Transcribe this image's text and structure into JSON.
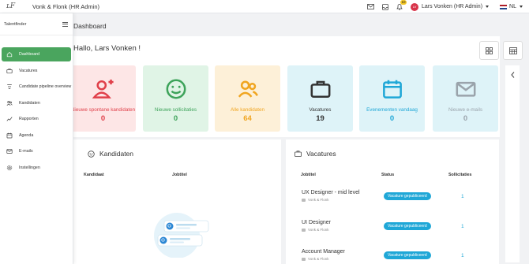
{
  "topbar": {
    "logo": "ʟF",
    "company": "Vonk & Flonk (HR Admin)",
    "notification_count": "10",
    "user_initials": "LV",
    "user_name": "Lars Vonken (HR Admin)",
    "language": "NL"
  },
  "sidebar": {
    "title": "Talentfinder",
    "items": [
      {
        "label": "Dashboard",
        "icon": "home-icon",
        "active": true
      },
      {
        "label": "Vacatures",
        "icon": "briefcase-icon"
      },
      {
        "label": "Candidate pipeline overview",
        "icon": "pipeline-icon"
      },
      {
        "label": "Kandidaten",
        "icon": "users-icon"
      },
      {
        "label": "Rapporten",
        "icon": "chart-line-icon"
      },
      {
        "label": "Agenda",
        "icon": "calendar-icon"
      },
      {
        "label": "E-mails",
        "icon": "mail-icon"
      },
      {
        "label": "Instellingen",
        "icon": "gear-icon"
      }
    ]
  },
  "main": {
    "page_title": "Dashboard",
    "welcome": "Hallo, Lars Vonken !"
  },
  "cards": [
    {
      "label": "Nieuwe spontane kandidaten",
      "value": "0",
      "icon": "user-plus-icon",
      "bg": "#fde6e6",
      "color": "#e0404a"
    },
    {
      "label": "Nieuwe sollicitaties",
      "value": "0",
      "icon": "smiley-icon",
      "bg": "#e0f4e6",
      "color": "#3da35a"
    },
    {
      "label": "Alle kandidaten",
      "value": "64",
      "icon": "users-icon",
      "bg": "#fdf0d8",
      "color": "#f0a520"
    },
    {
      "label": "Vacatures",
      "value": "19",
      "icon": "briefcase-icon",
      "bg": "#def3f8",
      "color": "#333333"
    },
    {
      "label": "Evenementen vandaag",
      "value": "0",
      "icon": "calendar-icon",
      "bg": "#def3f8",
      "color": "#1fa7d7"
    },
    {
      "label": "Nieuwe e-mails",
      "value": "0",
      "icon": "mail-icon",
      "bg": "#def3f8",
      "color": "#9aa3ab"
    }
  ],
  "kandidaten_panel": {
    "title": "Kandidaten",
    "col_candidate": "Kandidaat",
    "col_jobtitle": "Jobtitel"
  },
  "vacatures_panel": {
    "title": "Vacatures",
    "col_jobtitle": "Jobtitel",
    "col_status": "Status",
    "col_applications": "Sollicitaties",
    "rows": [
      {
        "title": "UX Designer - mid level",
        "company": "Vonk & Flonk",
        "status": "Vacature gepubliceerd",
        "applications": "1"
      },
      {
        "title": "UI Designer",
        "company": "Vonk & Flonk",
        "status": "Vacature gepubliceerd",
        "applications": "1"
      },
      {
        "title": "Account Manager",
        "company": "Vonk & Flonk",
        "status": "Vacature gepubliceerd",
        "applications": "1"
      }
    ]
  }
}
